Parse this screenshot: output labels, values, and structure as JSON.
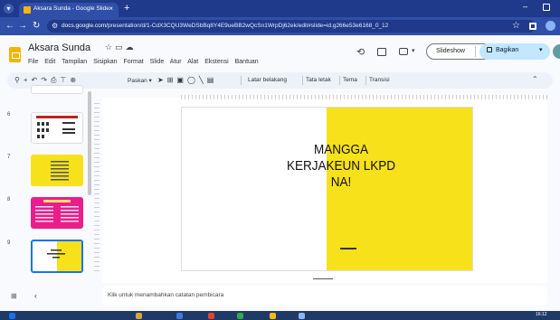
{
  "browser": {
    "tab_title": "Aksara Sunda - Google Slide",
    "new_tab": "+",
    "tab_close": "×",
    "url_domain": "docs.google.com",
    "url_path": "/presentation/d/1-CdX3CQU3WeDSbBq8Y4E9ueBB2wQcSn1WrpDj62ek/edit#slide=id.g266e53e6168_0_12"
  },
  "app": {
    "doc_title": "Aksara Sunda",
    "menus": [
      "File",
      "Edit",
      "Tampilan",
      "Sisipkan",
      "Format",
      "Slide",
      "Atur",
      "Alat",
      "Ekstensi",
      "Bantuan"
    ],
    "slideshow_label": "Slideshow",
    "share_label": "Bagikan"
  },
  "toolbar": {
    "zoom_label": "Paskan",
    "background_label": "Latar belakang",
    "layout_label": "Tata letak",
    "theme_label": "Tema",
    "transition_label": "Transisi"
  },
  "filmstrip": {
    "slides": [
      {
        "number": "6",
        "theme": "white-script"
      },
      {
        "number": "7",
        "theme": "yellow",
        "text": "KUMAHA CARA NGUNAKEUN AKSARA SUNDA KANA KECAP DAN KALIMAH?"
      },
      {
        "number": "8",
        "theme": "magenta",
        "text": "Pembagian Kelompok"
      },
      {
        "number": "9",
        "theme": "yellow-selected",
        "text": "MANGGA KERJAKEUN LKPD NA!"
      }
    ]
  },
  "slide": {
    "text": "MANGGA KERJAKEUN LKPD NA!",
    "colors": {
      "accent": "#f6e11b",
      "background": "#ffffff"
    }
  },
  "notes": {
    "placeholder": "Klik untuk menambahkan catatan pembicara"
  },
  "taskbar": {
    "time": "16:12"
  },
  "colors": {
    "chrome_dark": "#1f3a8a",
    "chrome": "#2f4fa8",
    "share_button": "#c2e7ff",
    "slide_yellow": "#f6e11b",
    "slide_magenta": "#e91e8c"
  }
}
